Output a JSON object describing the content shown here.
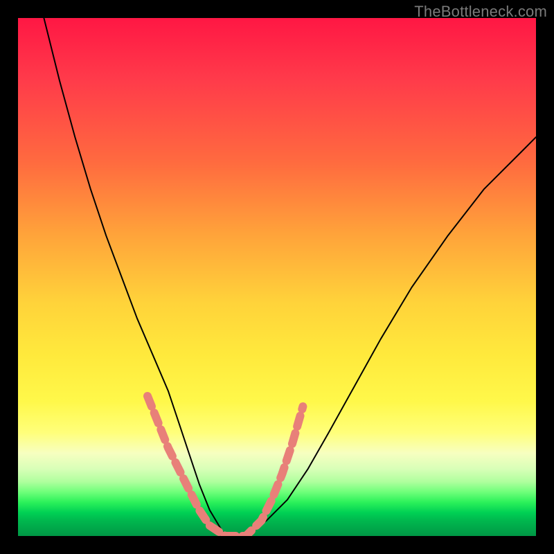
{
  "watermark": "TheBottleneck.com",
  "chart_data": {
    "type": "line",
    "title": "",
    "xlabel": "",
    "ylabel": "",
    "xlim": [
      0,
      100
    ],
    "ylim": [
      0,
      100
    ],
    "grid": false,
    "series": [
      {
        "name": "bottleneck-curve",
        "color": "#000000",
        "x": [
          5,
          8,
          11,
          14,
          17,
          20,
          23,
          26,
          29,
          31,
          33,
          35,
          37,
          40,
          44,
          48,
          52,
          56,
          60,
          65,
          70,
          76,
          83,
          90,
          97,
          100
        ],
        "y": [
          100,
          88,
          77,
          67,
          58,
          50,
          42,
          35,
          28,
          22,
          16,
          10,
          5,
          0,
          0,
          3,
          7,
          13,
          20,
          29,
          38,
          48,
          58,
          67,
          74,
          77
        ]
      }
    ],
    "highlight": {
      "name": "dotted-valley",
      "color": "#e88079",
      "x": [
        25,
        27,
        29,
        31,
        33,
        35,
        37,
        40,
        44,
        47,
        49,
        51,
        53,
        55
      ],
      "y": [
        27,
        22,
        17,
        13,
        9,
        5,
        2,
        0,
        0,
        3,
        7,
        12,
        18,
        25
      ]
    }
  }
}
